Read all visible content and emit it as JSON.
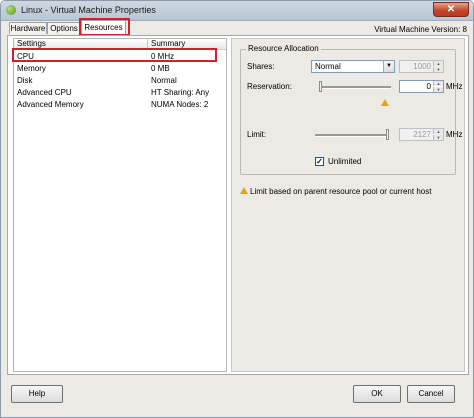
{
  "window": {
    "title": "Linux - Virtual Machine Properties",
    "close_label": "✕",
    "vm_version_label": "Virtual Machine Version: 8"
  },
  "tabs": [
    {
      "label": "Hardware",
      "active": false
    },
    {
      "label": "Options",
      "active": false
    },
    {
      "label": "Resources",
      "active": true
    }
  ],
  "settings_table": {
    "headers": [
      "Settings",
      "Summary"
    ],
    "rows": [
      {
        "setting": "CPU",
        "summary": "0 MHz",
        "selected": true
      },
      {
        "setting": "Memory",
        "summary": "0 MB",
        "selected": false
      },
      {
        "setting": "Disk",
        "summary": "Normal",
        "selected": false
      },
      {
        "setting": "Advanced CPU",
        "summary": "HT Sharing: Any",
        "selected": false
      },
      {
        "setting": "Advanced Memory",
        "summary": "NUMA Nodes: 2",
        "selected": false
      }
    ]
  },
  "resource_allocation": {
    "group_title": "Resource Allocation",
    "shares": {
      "label": "Shares:",
      "selected": "Normal",
      "value": "1000"
    },
    "reservation": {
      "label": "Reservation:",
      "value": "0",
      "unit": "MHz",
      "slider_level": 0
    },
    "limit": {
      "label": "Limit:",
      "value": "2127",
      "unit": "MHz",
      "slider_level": 1
    },
    "unlimited": {
      "label": "Unlimited",
      "checked": true
    },
    "warning_text": "Limit based on parent resource pool or current host"
  },
  "footer": {
    "help_label": "Help",
    "ok_label": "OK",
    "cancel_label": "Cancel"
  },
  "icons": {
    "app": "vm-app-icon",
    "close": "close-icon",
    "warning": "warning-icon"
  },
  "colors": {
    "highlight": "#d1202a",
    "warning": "#e1a31d"
  }
}
